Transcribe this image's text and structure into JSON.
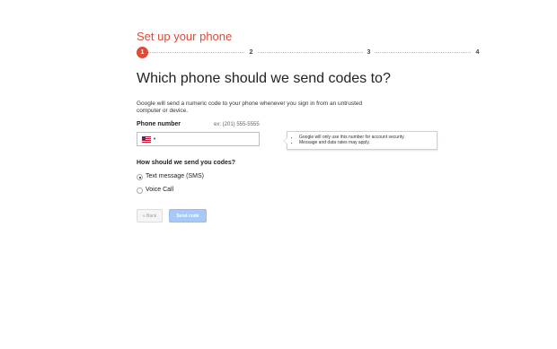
{
  "page": {
    "title": "Set up your phone"
  },
  "steps": [
    {
      "label": "1",
      "active": true
    },
    {
      "label": "2",
      "active": false
    },
    {
      "label": "3",
      "active": false
    },
    {
      "label": "4",
      "active": false
    }
  ],
  "main": {
    "heading": "Which phone should we send codes to?",
    "description": "Google will send a numeric code to your phone whenever you sign in from an untrusted computer or device."
  },
  "phone": {
    "label": "Phone number",
    "example": "ex: (201) 555-5555",
    "value": "",
    "country_icon": "us-flag-icon"
  },
  "tooltip": {
    "items": [
      "Google will only use this number for account security.",
      "Message and data rates may apply."
    ]
  },
  "delivery": {
    "question": "How should we send you codes?",
    "options": [
      {
        "label": "Text message (SMS)",
        "selected": true
      },
      {
        "label": "Voice Call",
        "selected": false
      }
    ]
  },
  "buttons": {
    "back": "« Back",
    "send": "Send code"
  },
  "colors": {
    "accent_red": "#dd4b39",
    "send_button": "#a8c8f8"
  }
}
